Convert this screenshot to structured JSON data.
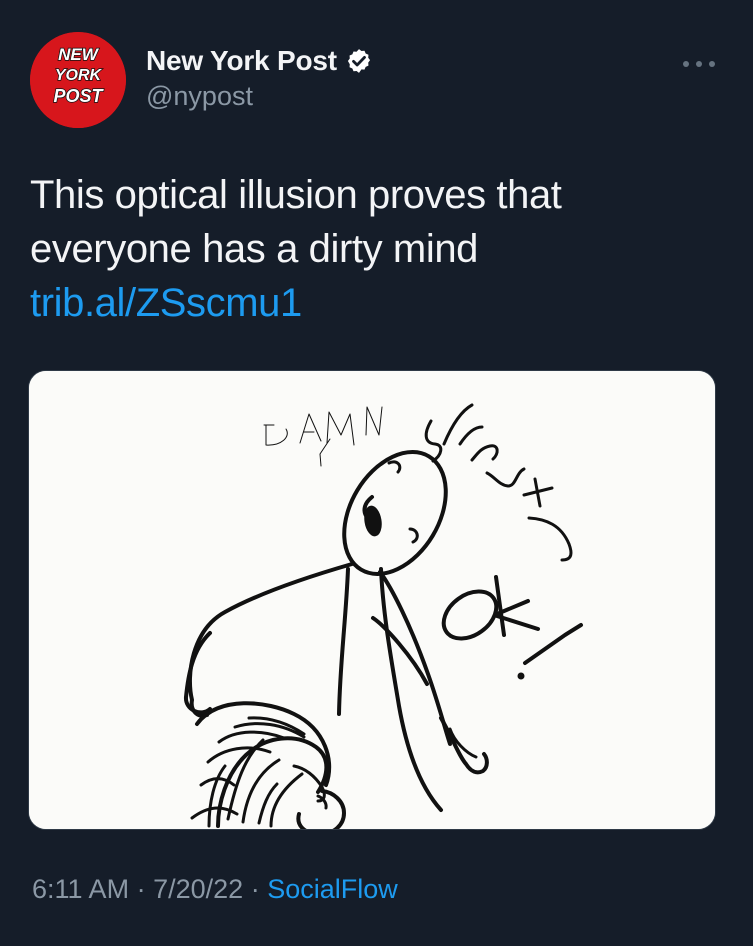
{
  "author": {
    "display_name": "New York Post",
    "handle": "@nypost",
    "avatar_text": [
      "NEW",
      "YORK",
      "POST"
    ],
    "verified": true
  },
  "tweet": {
    "text": "This optical illusion proves that everyone has a dirty mind",
    "link_text": "trib.al/ZSscmu1"
  },
  "media": {
    "drawing_text": [
      "DAMN",
      "Shawty",
      "OK!"
    ]
  },
  "meta": {
    "time": "6:11 AM",
    "date": "7/20/22",
    "source": "SocialFlow",
    "separator": "·"
  },
  "icons": {
    "more": "more-options-icon",
    "verified": "verified-badge-icon"
  },
  "colors": {
    "background": "#151d29",
    "text": "#f3f4f6",
    "muted": "#8b98a5",
    "link": "#1d9bf0",
    "brand_red": "#d7161c"
  }
}
